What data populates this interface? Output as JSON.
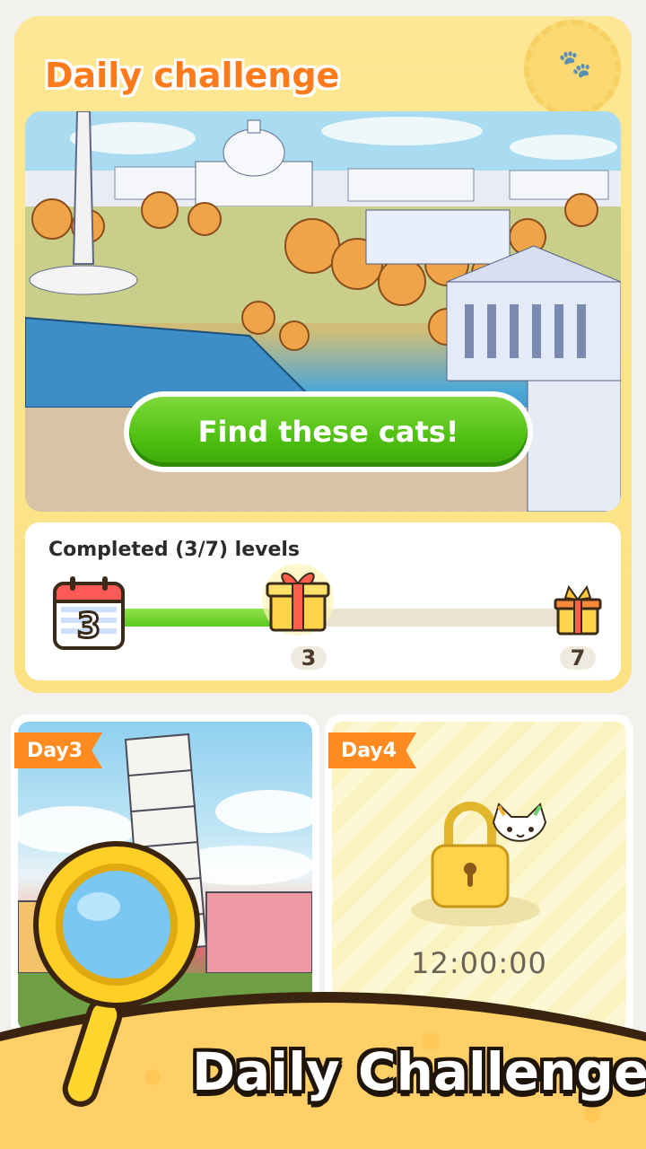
{
  "header": {
    "title": "Daily challenge"
  },
  "hero": {
    "button_label": "Find these cats!"
  },
  "progress": {
    "label": "Completed (3/7) levels",
    "completed": 3,
    "total": 7,
    "calendar_day": "3",
    "milestones": [
      "3",
      "7"
    ]
  },
  "days": [
    {
      "tag": "Day3",
      "locked": false
    },
    {
      "tag": "Day4",
      "locked": true,
      "timer": "12:00:00"
    }
  ],
  "banner": {
    "title": "Daily Challenge"
  },
  "colors": {
    "accent": "#ff8a1f",
    "primary_button": "#4fbf12",
    "card_bg": "#fbe28a"
  },
  "icons": [
    "paw-badge-icon",
    "calendar-icon",
    "gift-icon",
    "lock-icon",
    "cat-icon",
    "magnifier-icon"
  ]
}
